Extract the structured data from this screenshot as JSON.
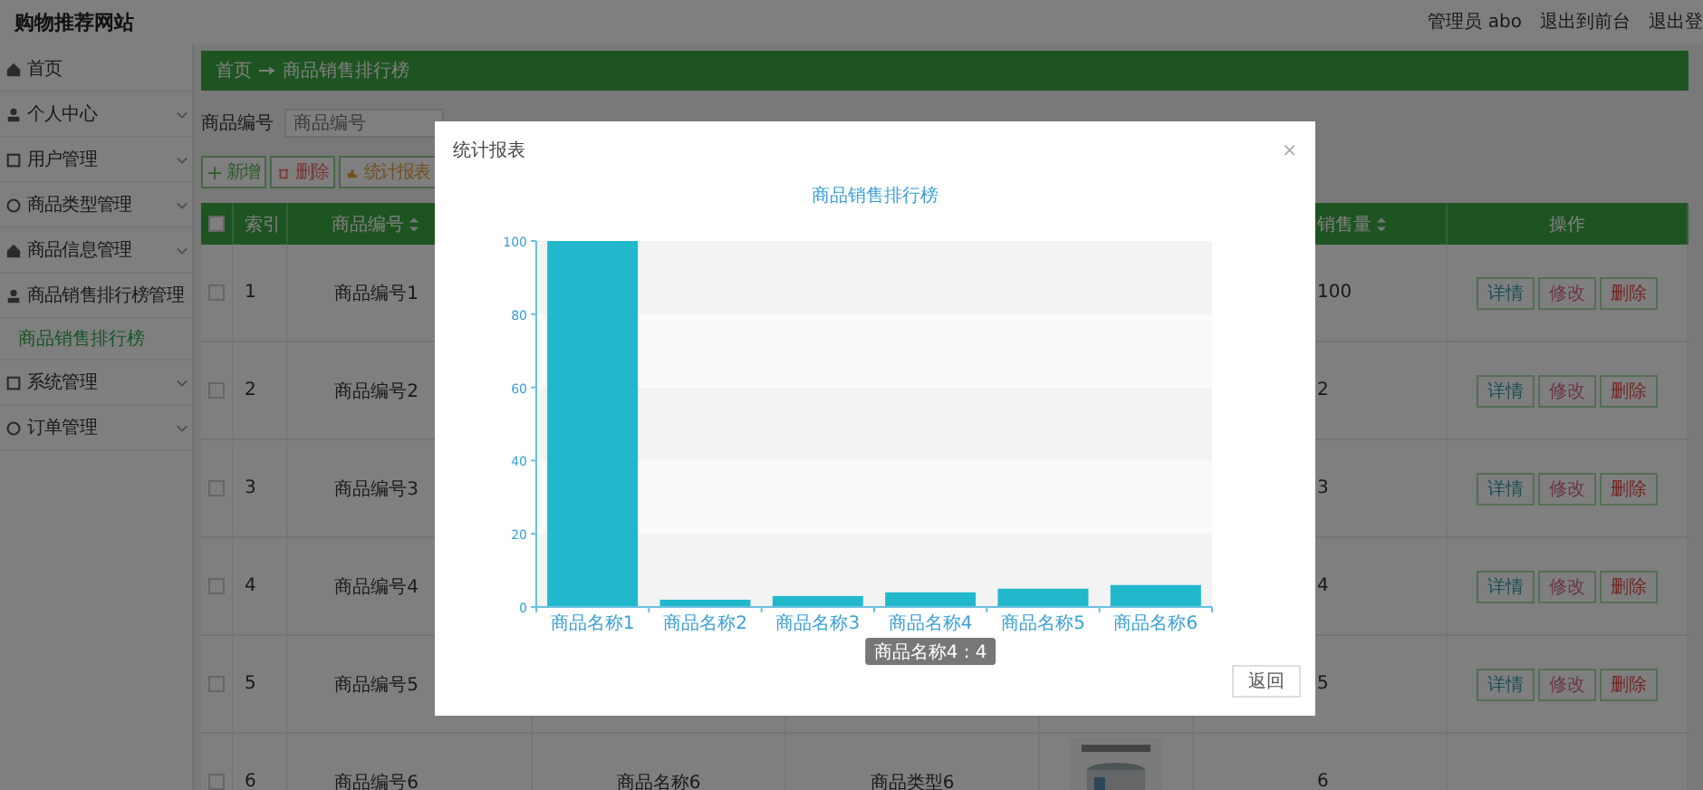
{
  "header": {
    "title": "购物推荐网站",
    "links": [
      "管理员 abo",
      "退出到前台",
      "退出登"
    ]
  },
  "sidebar": {
    "items": [
      {
        "kind": "link",
        "label": "首页",
        "selected": false
      },
      {
        "kind": "menu",
        "label": "个人中心",
        "expanded": false
      },
      {
        "kind": "menu",
        "label": "用户管理",
        "expanded": false
      },
      {
        "kind": "menu",
        "label": "商品类型管理",
        "expanded": false
      },
      {
        "kind": "menu",
        "label": "商品信息管理",
        "expanded": false
      },
      {
        "kind": "menu",
        "label": "商品销售排行榜管理",
        "expanded": true,
        "children": [
          {
            "label": "商品销售排行榜",
            "selected": true
          }
        ]
      },
      {
        "kind": "menu",
        "label": "系统管理",
        "expanded": false
      },
      {
        "kind": "menu",
        "label": "订单管理",
        "expanded": false
      }
    ]
  },
  "breadcrumb": [
    "首页",
    "商品销售排行榜"
  ],
  "search": [
    {
      "label": "商品编号",
      "placeholder": "商品编号"
    }
  ],
  "toolbar": [
    {
      "kind": "add",
      "label": "新增"
    },
    {
      "kind": "delete",
      "label": "删除"
    },
    {
      "kind": "report",
      "label": "统计报表"
    }
  ],
  "table": {
    "columns": [
      {
        "kind": "check",
        "checked": false
      },
      {
        "kind": "text",
        "label": "索引"
      },
      {
        "kind": "sort",
        "label": "商品编号"
      },
      {
        "kind": "blank"
      },
      {
        "kind": "blank"
      },
      {
        "kind": "blank"
      },
      {
        "kind": "sort",
        "label": "销售量"
      },
      {
        "kind": "text",
        "label": "操作"
      }
    ],
    "rows": [
      {
        "checked": false,
        "index": "1",
        "code": "商品编号1",
        "sales": "100",
        "actions": [
          "详情",
          "修改",
          "删除"
        ]
      },
      {
        "checked": false,
        "index": "2",
        "code": "商品编号2",
        "sales": "2",
        "actions": [
          "详情",
          "修改",
          "删除"
        ]
      },
      {
        "checked": false,
        "index": "3",
        "code": "商品编号3",
        "sales": "3",
        "actions": [
          "详情",
          "修改",
          "删除"
        ]
      },
      {
        "checked": false,
        "index": "4",
        "code": "商品编号4",
        "sales": "4",
        "actions": [
          "详情",
          "修改",
          "删除"
        ]
      },
      {
        "checked": false,
        "index": "5",
        "code": "商品编号5",
        "sales": "5",
        "actions": [
          "详情",
          "修改",
          "删除"
        ]
      },
      {
        "checked": false,
        "index": "6",
        "code": "商品编号6",
        "name": "商品名称6",
        "type": "商品类型6",
        "sales": "6"
      }
    ]
  },
  "modal": {
    "title": "统计报表",
    "close": "×",
    "chart_data": {
      "type": "bar",
      "title": "商品销售排行榜",
      "categories": [
        "商品名称1",
        "商品名称2",
        "商品名称3",
        "商品名称4",
        "商品名称5",
        "商品名称6"
      ],
      "values": [
        100,
        2,
        3,
        4,
        5,
        6
      ],
      "ylim": [
        0,
        100
      ],
      "yticks": [
        0,
        20,
        40,
        60,
        80,
        100
      ]
    },
    "tooltip": "商品名称4 : 4",
    "button": "返回"
  }
}
